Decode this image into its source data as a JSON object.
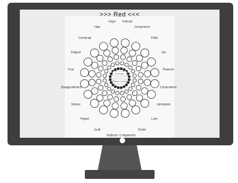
{
  "title": ">>> Red <<<",
  "center": {
    "no_emotion": "No emotion",
    "different_emotion": "Different emotion"
  },
  "emotions": [
    "Interest",
    "Amusement",
    "Pride",
    "Joy",
    "Pleasure",
    "Contentment",
    "Admiration",
    "Love",
    "Relief",
    "Compassion",
    "Sadness",
    "Guilt",
    "Regret",
    "Shame",
    "Disappointment",
    "Fear",
    "Disgust",
    "Contempt",
    "Hate",
    "Anger"
  ],
  "colors": {
    "bezel": "#3e3e3e",
    "screen": "#ececec",
    "panel": "#f8f8f8",
    "stand": "#555555"
  }
}
